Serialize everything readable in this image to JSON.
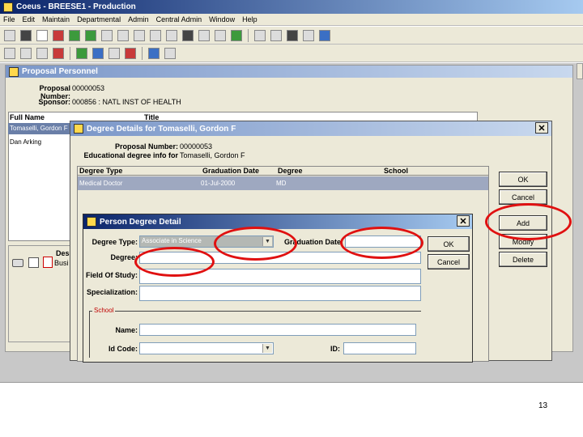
{
  "app": {
    "title": "Coeus - BREESE1 - Production"
  },
  "menu": [
    "File",
    "Edit",
    "Maintain",
    "Departmental",
    "Admin",
    "Central Admin",
    "Window",
    "Help"
  ],
  "proposal_personnel": {
    "title": "Proposal Personnel",
    "proposal_number_label": "Proposal Number:",
    "proposal_number": "00000053",
    "sponsor_label": "Sponsor:",
    "sponsor": "000856 : NATL INST OF HEALTH",
    "col_full_name": "Full Name",
    "col_title": "Title",
    "rows": [
      "Tomaselli, Gordon F",
      "Dan Arking"
    ],
    "desc_label": "Des",
    "desc_value": "Busi"
  },
  "degree_details": {
    "title": "Degree Details for Tomaselli, Gordon F",
    "proposal_number_label": "Proposal Number:",
    "proposal_number": "00000053",
    "info_label": "Educational degree info for",
    "info_value": "Tomaselli, Gordon F",
    "columns": [
      "Degree Type",
      "Graduation Date",
      "Degree",
      "School"
    ],
    "row": {
      "degree_type": "Medical Doctor",
      "graduation_date": "01-Jul-2000",
      "degree": "MD",
      "school": ""
    },
    "buttons": {
      "ok": "OK",
      "cancel": "Cancel",
      "add": "Add",
      "modify": "Modify",
      "delete": "Delete"
    }
  },
  "person_degree": {
    "title": "Person Degree Detail",
    "degree_type_label": "Degree Type:",
    "degree_type_value": "Associate in Science",
    "graduation_date_label": "Graduation Date:",
    "graduation_date_value": "",
    "degree_label": "Degree:",
    "degree_value": "",
    "field_of_study_label": "Field Of Study:",
    "specialization_label": "Specialization:",
    "school_group_label": "School",
    "name_label": "Name:",
    "id_code_label": "Id Code:",
    "id_label": "ID:",
    "buttons": {
      "ok": "OK",
      "cancel": "Cancel"
    }
  },
  "page_number": "13",
  "colors": {
    "annotation": "#e01010",
    "title_active": "#0a246a",
    "selected_row": "#9ea8c0"
  }
}
